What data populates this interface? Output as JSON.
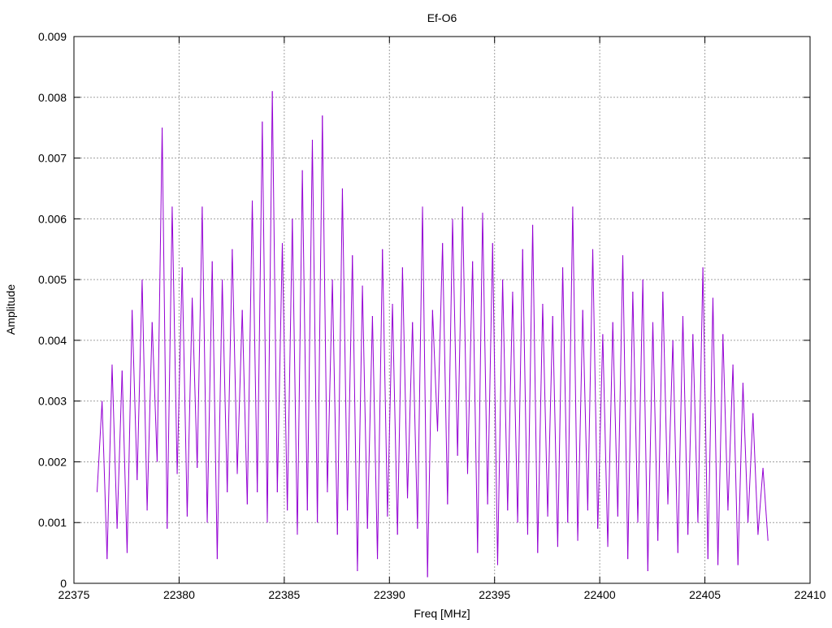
{
  "chart_data": {
    "type": "line",
    "title": "Ef-O6",
    "xlabel": "Freq [MHz]",
    "ylabel": "Amplitude",
    "xlim": [
      22375,
      22410
    ],
    "ylim": [
      0,
      0.009
    ],
    "grid": true,
    "x_ticks": [
      "22375",
      "22380",
      "22385",
      "22390",
      "22395",
      "22400",
      "22405",
      "22410"
    ],
    "x_tick_values": [
      22375,
      22380,
      22385,
      22390,
      22395,
      22400,
      22405,
      22410
    ],
    "y_ticks": [
      "0",
      "0.001",
      "0.002",
      "0.003",
      "0.004",
      "0.005",
      "0.006",
      "0.007",
      "0.008",
      "0.009"
    ],
    "y_tick_values": [
      0,
      0.001,
      0.002,
      0.003,
      0.004,
      0.005,
      0.006,
      0.007,
      0.008,
      0.009
    ],
    "series": [
      {
        "name": "Ef-O6",
        "color": "#9400d3",
        "x_range": [
          22376.1,
          22408.0
        ],
        "values": [
          0.0015,
          0.003,
          0.0004,
          0.0036,
          0.0009,
          0.0035,
          0.0005,
          0.0045,
          0.0017,
          0.005,
          0.0012,
          0.0043,
          0.002,
          0.0075,
          0.0009,
          0.0062,
          0.0018,
          0.0052,
          0.0011,
          0.0047,
          0.0019,
          0.0062,
          0.001,
          0.0053,
          0.0004,
          0.005,
          0.0015,
          0.0055,
          0.0018,
          0.0045,
          0.0013,
          0.0063,
          0.0015,
          0.0076,
          0.001,
          0.0081,
          0.0015,
          0.0056,
          0.0012,
          0.006,
          0.0008,
          0.0068,
          0.0012,
          0.0073,
          0.001,
          0.0077,
          0.0015,
          0.005,
          0.0008,
          0.0065,
          0.0012,
          0.0054,
          0.0002,
          0.0049,
          0.0009,
          0.0044,
          0.0004,
          0.0055,
          0.0011,
          0.0046,
          0.0008,
          0.0052,
          0.0014,
          0.0043,
          0.0009,
          0.0062,
          0.0001,
          0.0045,
          0.0025,
          0.0056,
          0.0013,
          0.006,
          0.0021,
          0.0062,
          0.0018,
          0.0053,
          0.0005,
          0.0061,
          0.0013,
          0.0056,
          0.0003,
          0.005,
          0.0012,
          0.0048,
          0.001,
          0.0055,
          0.0008,
          0.0059,
          0.0005,
          0.0046,
          0.0011,
          0.0044,
          0.0006,
          0.0052,
          0.001,
          0.0062,
          0.0007,
          0.0045,
          0.0012,
          0.0055,
          0.0009,
          0.0041,
          0.0006,
          0.0043,
          0.0011,
          0.0054,
          0.0004,
          0.0048,
          0.001,
          0.005,
          0.0002,
          0.0043,
          0.0007,
          0.0048,
          0.0013,
          0.004,
          0.0005,
          0.0044,
          0.0008,
          0.0041,
          0.001,
          0.0052,
          0.0004,
          0.0047,
          0.0003,
          0.0041,
          0.0012,
          0.0036,
          0.0003,
          0.0033,
          0.001,
          0.0028,
          0.0008,
          0.0019,
          0.0007
        ]
      }
    ]
  }
}
